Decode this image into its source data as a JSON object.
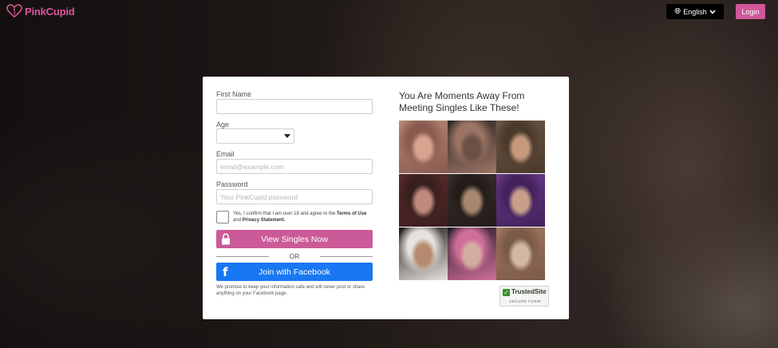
{
  "header": {
    "logo_text": "PinkCupid",
    "language": "English",
    "login_label": "Login"
  },
  "form": {
    "first_name_label": "First Name",
    "age_label": "Age",
    "email_label": "Email",
    "email_placeholder": "email@example.com",
    "password_label": "Password",
    "password_placeholder": "Your PinkCupid password",
    "consent_prefix": "Yes, I confirm that I am over 18 and agree to the",
    "consent_terms": "Terms of Use",
    "consent_and": "and",
    "consent_privacy": "Privacy Statement.",
    "view_singles_label": "View Singles Now",
    "or_label": "OR",
    "facebook_label": "Join with Facebook",
    "facebook_note": "We promise to keep your information safe and will never post or share anything on your Facebook page."
  },
  "promo": {
    "headline": "You Are Moments Away From Meeting Singles Like These!",
    "photos": [
      {
        "colors": [
          "#b98a77",
          "#d9a48f",
          "#8a5a50"
        ]
      },
      {
        "colors": [
          "#2a2420",
          "#6b5046",
          "#9c7465"
        ]
      },
      {
        "colors": [
          "#6e5744",
          "#c79a7e",
          "#4a3a2c"
        ]
      },
      {
        "colors": [
          "#5a2b2b",
          "#c08a7c",
          "#3a1f1f"
        ]
      },
      {
        "colors": [
          "#3a2e2a",
          "#a7876f",
          "#231c19"
        ]
      },
      {
        "colors": [
          "#6c3a8c",
          "#c8a08a",
          "#42225a"
        ]
      },
      {
        "colors": [
          "#1a1412",
          "#b58a6f",
          "#e8e2de"
        ]
      },
      {
        "colors": [
          "#1c1a22",
          "#d2aea0",
          "#d06e9a"
        ]
      },
      {
        "colors": [
          "#a57a62",
          "#d4b8a6",
          "#7a5a48"
        ]
      }
    ],
    "trusted_title": "TrustedSite",
    "trusted_sub": "SECURE FORM"
  }
}
